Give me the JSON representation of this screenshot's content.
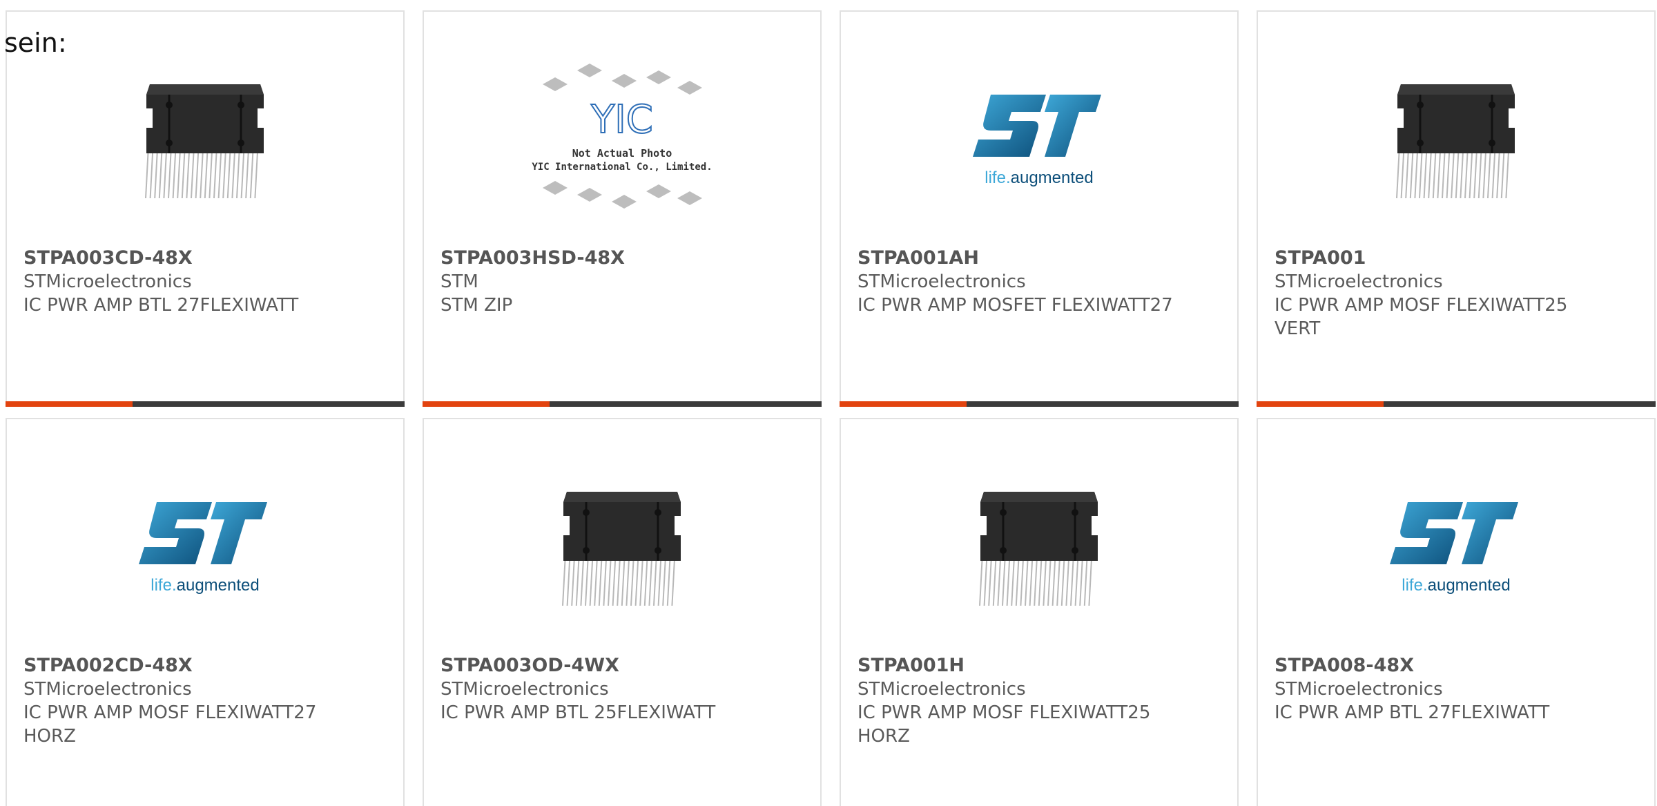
{
  "intro_text": "sein:",
  "accent_color": "#e2430f",
  "bar_color": "#3b3b3b",
  "products": [
    {
      "part": "STPA003CD-48X",
      "manufacturer": "STMicroelectronics",
      "description": "IC PWR AMP BTL 27FLEXIWATT",
      "image": "chip-image"
    },
    {
      "part": "STPA003HSD-48X",
      "manufacturer": "STM",
      "description": "STM ZIP",
      "image": "yic-placeholder",
      "placeholder_line1": "Not Actual Photo",
      "placeholder_line2": "YIC International Co., Limited.",
      "placeholder_logo": "YIC"
    },
    {
      "part": "STPA001AH",
      "manufacturer": "STMicroelectronics",
      "description": "IC PWR AMP MOSFET FLEXIWATT27",
      "image": "st-logo",
      "logo_tagline": "life.augmented"
    },
    {
      "part": "STPA001",
      "manufacturer": "STMicroelectronics",
      "description": "IC PWR AMP MOSF FLEXIWATT25 VERT",
      "image": "chip-image"
    },
    {
      "part": "STPA002CD-48X",
      "manufacturer": "STMicroelectronics",
      "description": "IC PWR AMP MOSF FLEXIWATT27 HORZ",
      "image": "st-logo",
      "logo_tagline": "life.augmented"
    },
    {
      "part": "STPA003OD-4WX",
      "manufacturer": "STMicroelectronics",
      "description": "IC PWR AMP BTL 25FLEXIWATT",
      "image": "chip-image"
    },
    {
      "part": "STPA001H",
      "manufacturer": "STMicroelectronics",
      "description": "IC PWR AMP MOSF FLEXIWATT25 HORZ",
      "image": "chip-image"
    },
    {
      "part": "STPA008-48X",
      "manufacturer": "STMicroelectronics",
      "description": "IC PWR AMP BTL 27FLEXIWATT",
      "image": "st-logo",
      "logo_tagline": "life.augmented"
    }
  ]
}
